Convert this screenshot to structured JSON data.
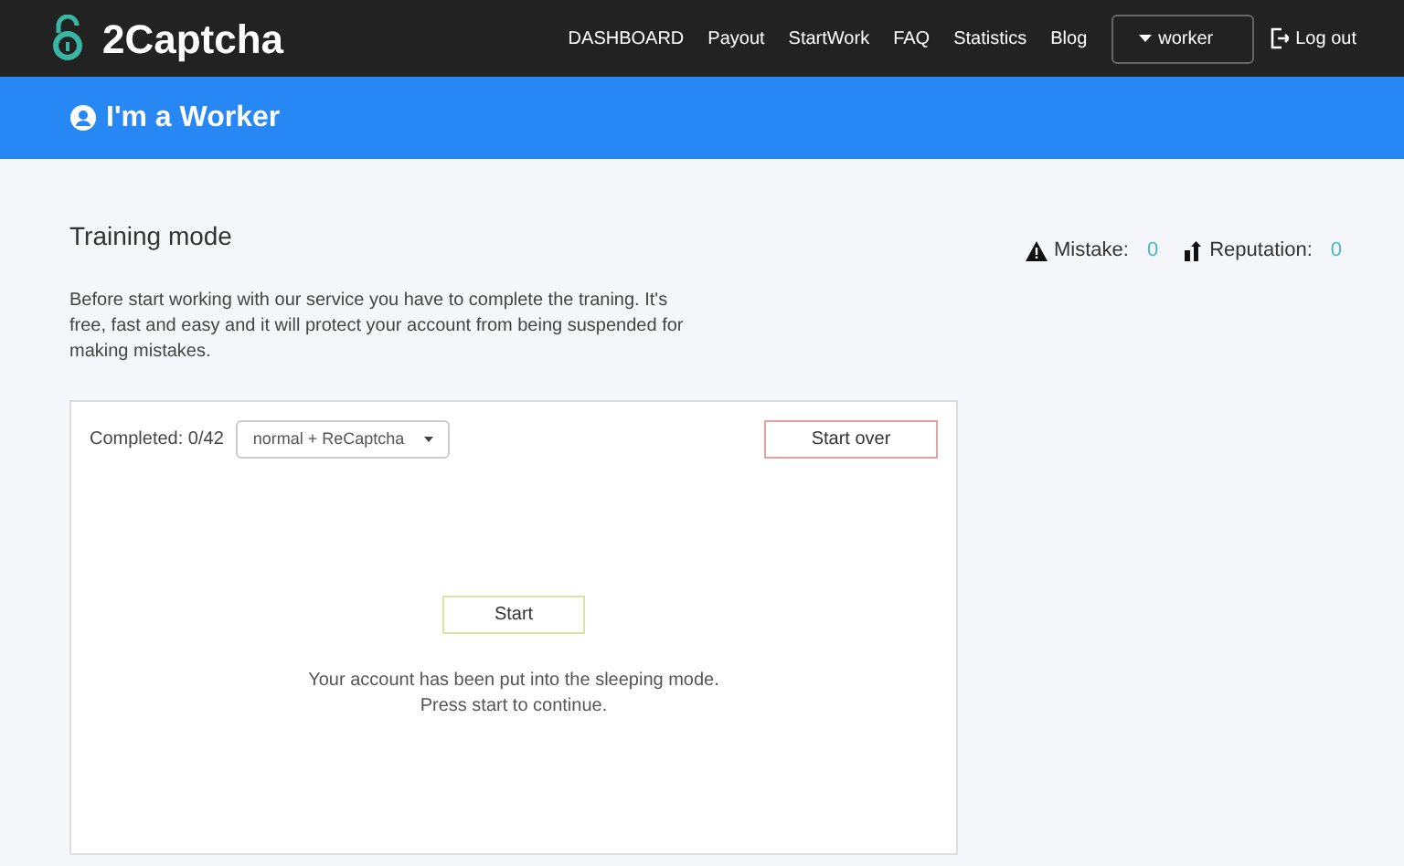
{
  "brand": "2Captcha",
  "nav": [
    {
      "label": "DASHBOARD"
    },
    {
      "label": "Payout"
    },
    {
      "label": "StartWork"
    },
    {
      "label": "FAQ"
    },
    {
      "label": "Statistics"
    },
    {
      "label": "Blog"
    }
  ],
  "user_menu": {
    "label": "worker"
  },
  "logout": {
    "label": "Log out"
  },
  "banner": {
    "title": "I'm a Worker"
  },
  "page_title": "Training mode",
  "stats": [
    {
      "kind": "mistake",
      "label": "Mistake:",
      "value": "0"
    },
    {
      "kind": "reputation",
      "label": "Reputation:",
      "value": "0"
    }
  ],
  "intro": "Before start working with our service you have to complete the traning. It's free, fast and easy and it will protect your account from being suspended for making mistakes.",
  "panel": {
    "completed": "Completed: 0/42",
    "mode_select": {
      "value": "normal + ReCaptcha"
    },
    "start_over": "Start over",
    "start": "Start",
    "message_lines": [
      "Your account has been put into the sleeping mode.",
      "Press start to continue."
    ]
  }
}
